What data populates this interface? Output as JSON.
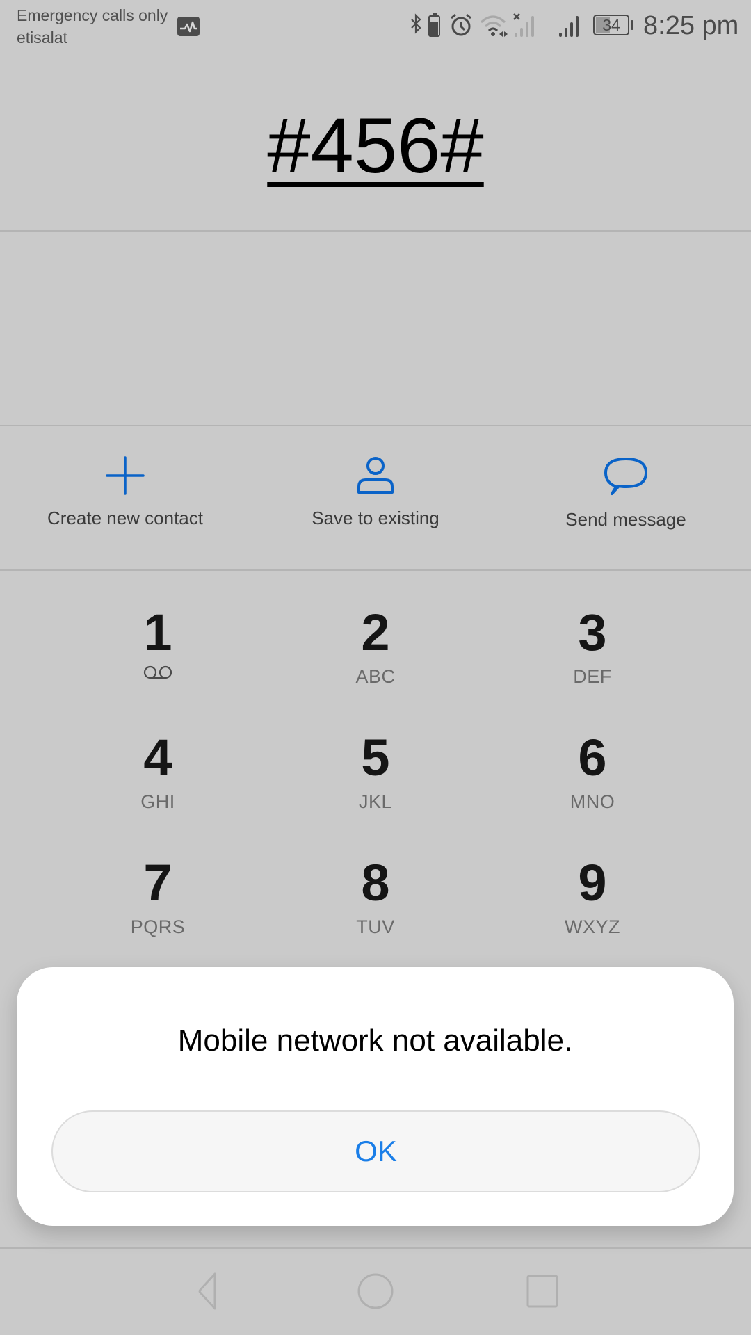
{
  "status_bar": {
    "carrier_status": "Emergency calls only",
    "carrier_name": "etisalat",
    "battery_percent": "34",
    "time": "8:25 pm",
    "icons": [
      "pulse-icon",
      "bluetooth-icon",
      "bluetooth-battery-icon",
      "alarm-icon",
      "wifi-icon",
      "sim1-signal-no-service-icon",
      "sim2-signal-icon",
      "battery-icon"
    ]
  },
  "dialer": {
    "number": "#456#",
    "actions": [
      {
        "label": "Create new contact",
        "icon": "plus-icon"
      },
      {
        "label": "Save to existing",
        "icon": "person-icon"
      },
      {
        "label": "Send message",
        "icon": "chat-bubble-icon"
      }
    ],
    "keys": [
      {
        "digit": "1",
        "letters": "",
        "icon": "voicemail-icon"
      },
      {
        "digit": "2",
        "letters": "ABC"
      },
      {
        "digit": "3",
        "letters": "DEF"
      },
      {
        "digit": "4",
        "letters": "GHI"
      },
      {
        "digit": "5",
        "letters": "JKL"
      },
      {
        "digit": "6",
        "letters": "MNO"
      },
      {
        "digit": "7",
        "letters": "PQRS"
      },
      {
        "digit": "8",
        "letters": "TUV"
      },
      {
        "digit": "9",
        "letters": "WXYZ"
      }
    ]
  },
  "dialog": {
    "message": "Mobile network not available.",
    "ok_label": "OK"
  },
  "nav_bar": {
    "buttons": [
      "back-icon",
      "home-icon",
      "recents-icon"
    ]
  },
  "colors": {
    "background": "#cacaca",
    "accent": "#0a63c8",
    "dialog_button_text": "#1a7ee8",
    "divider": "#b4b4b4"
  }
}
